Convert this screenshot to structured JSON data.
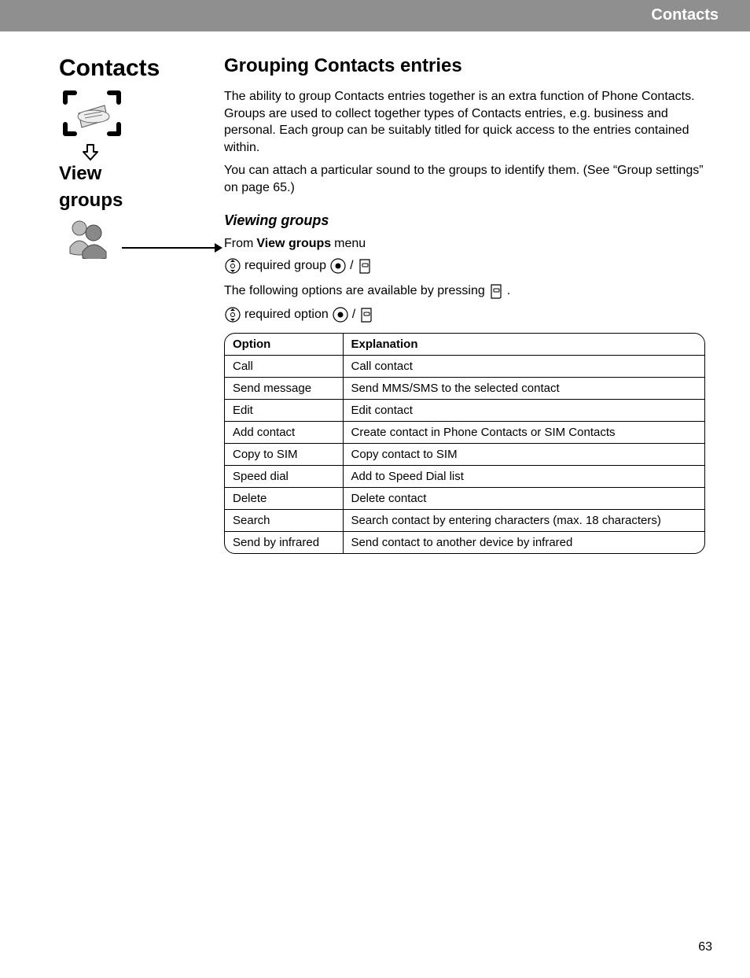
{
  "header": {
    "title": "Contacts"
  },
  "sidebar": {
    "title": "Contacts",
    "sub1": "View",
    "sub2": "groups"
  },
  "main": {
    "section_title": "Grouping Contacts entries",
    "para1": "The ability to group Contacts entries together is an extra function of Phone Contacts. Groups are used to collect together types of Contacts entries, e.g. business and personal. Each group can be suitably titled for quick access to the entries contained within.",
    "para2": "You can attach a particular sound to the groups to identify them. (See “Group settings” on page 65.)",
    "subheading": "Viewing groups",
    "from_label": "From ",
    "from_menu_bold": "View groups",
    "from_suffix": " menu",
    "step_group": " required group ",
    "slash": " / ",
    "following_text": "The following options are available by pressing ",
    "period": ".",
    "step_option": " required option ",
    "table": {
      "headers": [
        "Option",
        "Explanation"
      ],
      "rows": [
        [
          "Call",
          "Call contact"
        ],
        [
          "Send message",
          "Send MMS/SMS to the selected contact"
        ],
        [
          "Edit",
          "Edit contact"
        ],
        [
          "Add contact",
          "Create contact in Phone Contacts or SIM Contacts"
        ],
        [
          "Copy to SIM",
          "Copy contact to SIM"
        ],
        [
          "Speed dial",
          "Add to Speed Dial list"
        ],
        [
          "Delete",
          "Delete contact"
        ],
        [
          "Search",
          "Search contact by entering characters (max. 18 characters)"
        ],
        [
          "Send by infrared",
          "Send contact to another device by infrared"
        ]
      ]
    }
  },
  "page_number": "63"
}
